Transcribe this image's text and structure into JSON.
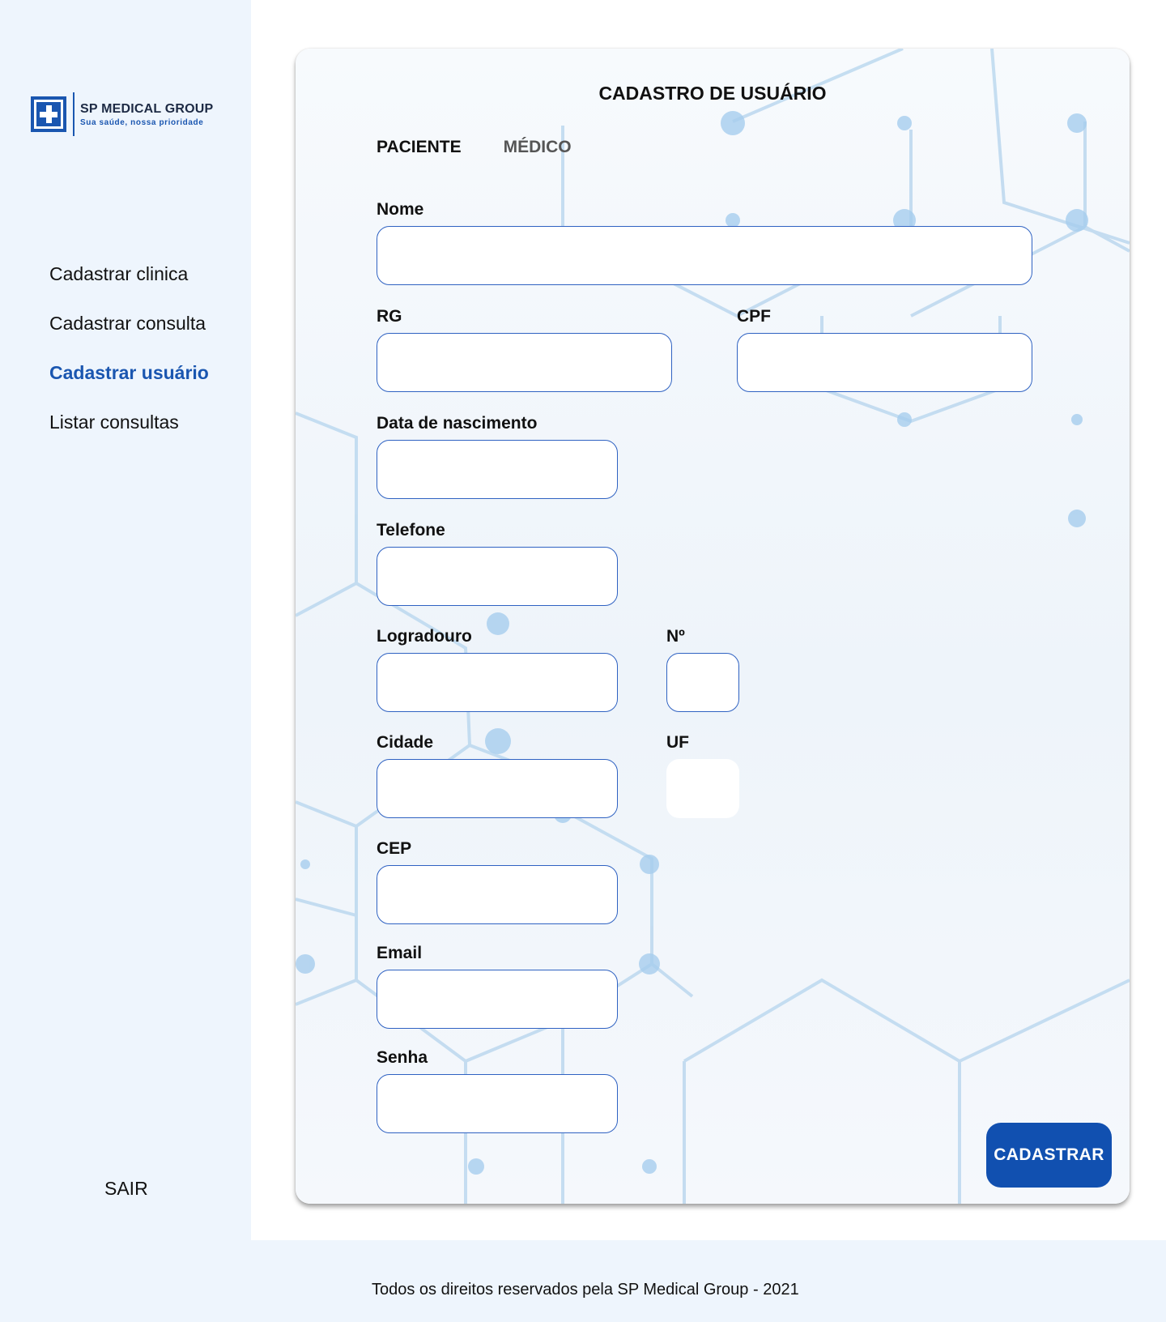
{
  "brand": {
    "name": "SP MEDICAL GROUP",
    "tagline": "Sua saúde, nossa prioridade",
    "primary_color": "#1a56b0"
  },
  "sidebar": {
    "items": [
      {
        "label": "Cadastrar clinica",
        "active": false
      },
      {
        "label": "Cadastrar consulta",
        "active": false
      },
      {
        "label": "Cadastrar usuário",
        "active": true
      },
      {
        "label": "Listar consultas",
        "active": false
      }
    ],
    "logout_label": "SAIR"
  },
  "form": {
    "title": "CADASTRO DE USUÁRIO",
    "tabs": [
      {
        "label": "PACIENTE",
        "active": true
      },
      {
        "label": "MÉDICO",
        "active": false
      }
    ],
    "fields": {
      "nome": {
        "label": "Nome",
        "value": ""
      },
      "rg": {
        "label": "RG",
        "value": ""
      },
      "cpf": {
        "label": "CPF",
        "value": ""
      },
      "data_nascimento": {
        "label": "Data de nascimento",
        "value": ""
      },
      "telefone": {
        "label": "Telefone",
        "value": ""
      },
      "logradouro": {
        "label": "Logradouro",
        "value": ""
      },
      "numero": {
        "label": "Nº",
        "value": ""
      },
      "cidade": {
        "label": "Cidade",
        "value": ""
      },
      "uf": {
        "label": "UF",
        "value": ""
      },
      "cep": {
        "label": "CEP",
        "value": ""
      },
      "email": {
        "label": "Email",
        "value": ""
      },
      "senha": {
        "label": "Senha",
        "value": ""
      }
    },
    "submit_label": "CADASTRAR"
  },
  "footer": {
    "text": "Todos os direitos reservados pela SP Medical Group - 2021"
  }
}
